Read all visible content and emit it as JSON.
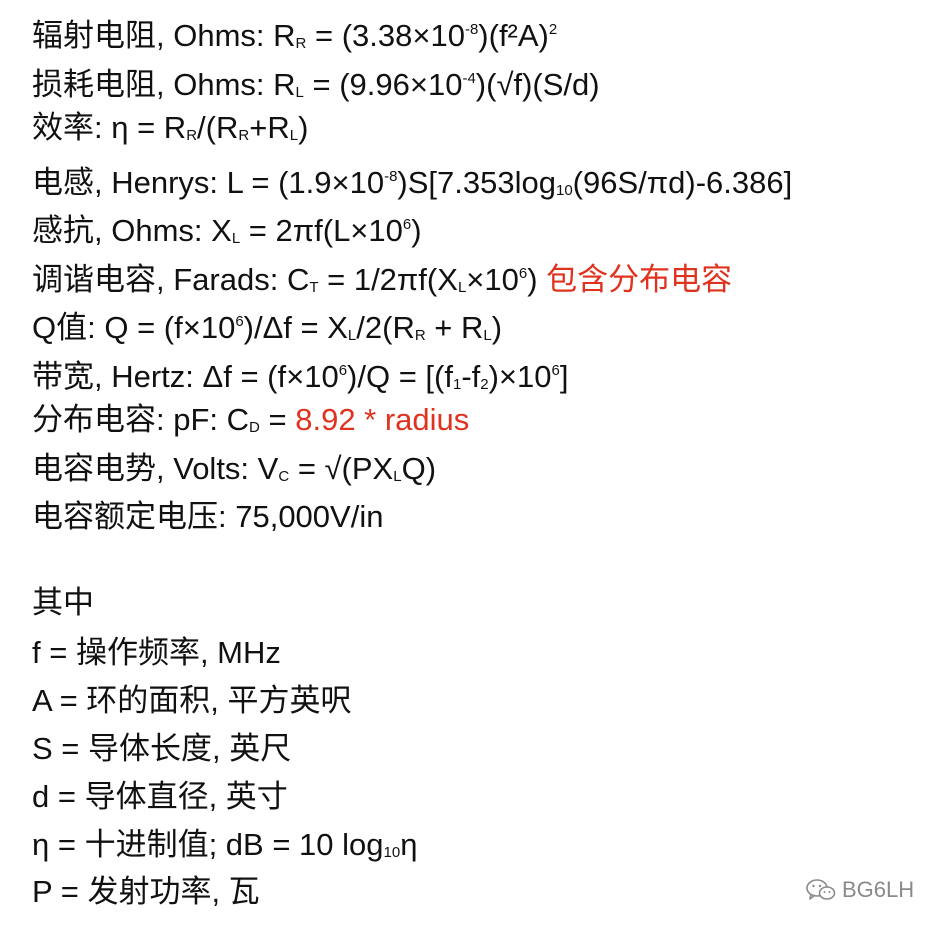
{
  "formulas": {
    "radiation_resistance": {
      "label": "辐射电阻, Ohms: ",
      "p1": "R",
      "s1": "R",
      "p2": " = (3.38×10",
      "e1": "-8",
      "p3": ")(f²A)",
      "e2": "2"
    },
    "loss_resistance": {
      "label": "损耗电阻, Ohms: ",
      "p1": "R",
      "s1": "L",
      "p2": " = (9.96×10",
      "e1": "-4",
      "p3": ")(√f)(S/d)"
    },
    "efficiency": {
      "label": "效率: ",
      "p1": "η = R",
      "s1": "R",
      "p2": "/(R",
      "s2": "R",
      "p3": "+R",
      "s3": "L",
      "p4": ")"
    },
    "inductance": {
      "label": "电感, Henrys: ",
      "p1": "L = (1.9×10",
      "e1": "-8",
      "p2": ")S[7.353log",
      "s1": "10",
      "p3": "(96S/πd)-6.386]"
    },
    "reactance": {
      "label": "感抗, Ohms: ",
      "p1": "X",
      "s1": "L",
      "p2": " = 2πf(L×10",
      "e1": "6",
      "p3": ")"
    },
    "tuning_capacitance": {
      "label": "调谐电容, Farads: ",
      "p1": "C",
      "s1": "T",
      "p2": " = 1/2πf(X",
      "s2": "L",
      "p3": "×10",
      "e1": "6",
      "p4": ") ",
      "note": "包含分布电容"
    },
    "q_value": {
      "label": "Q值: ",
      "p1": "Q = (f×10",
      "e1": "6",
      "p2": ")/Δf = X",
      "s1": "L",
      "p3": "/2(R",
      "s2": "R",
      "p4": " + R",
      "s3": "L",
      "p5": ")"
    },
    "bandwidth": {
      "label": "带宽, Hertz: ",
      "p1": "Δf = (f×10",
      "e1": "6",
      "p2": ")/Q = [(f",
      "s1": "1",
      "p3": "-f",
      "s2": "2",
      "p4": ")×10",
      "e2": "6",
      "p5": "]"
    },
    "distributed_capacitance": {
      "label": "分布电容: pF: ",
      "p1": "C",
      "s1": "D",
      "p2": " = ",
      "note": "8.92 * radius"
    },
    "capacitor_voltage": {
      "label": "电容电势, Volts: ",
      "p1": "V",
      "s1": "C",
      "p2": " = √(PX",
      "s2": "L",
      "p3": "Q)"
    },
    "capacitor_rating": {
      "label": "电容额定电压: 75,000V/in"
    }
  },
  "where": {
    "heading": "其中",
    "f": "f = 操作频率, MHz",
    "A": "A = 环的面积, 平方英呎",
    "S": "S = 导体长度, 英尺",
    "d": "d = 导体直径, 英寸",
    "eta_p1": "η = 十进制值; dB = 10 log",
    "eta_s1": "10",
    "eta_p2": "η",
    "P": "P = 发射功率, 瓦"
  },
  "watermark": {
    "text": "BG6LH",
    "icon": "wechat-icon"
  },
  "colors": {
    "text": "#111111",
    "highlight": "#e0331f",
    "watermark": "#8a8a8a",
    "background": "#ffffff"
  }
}
